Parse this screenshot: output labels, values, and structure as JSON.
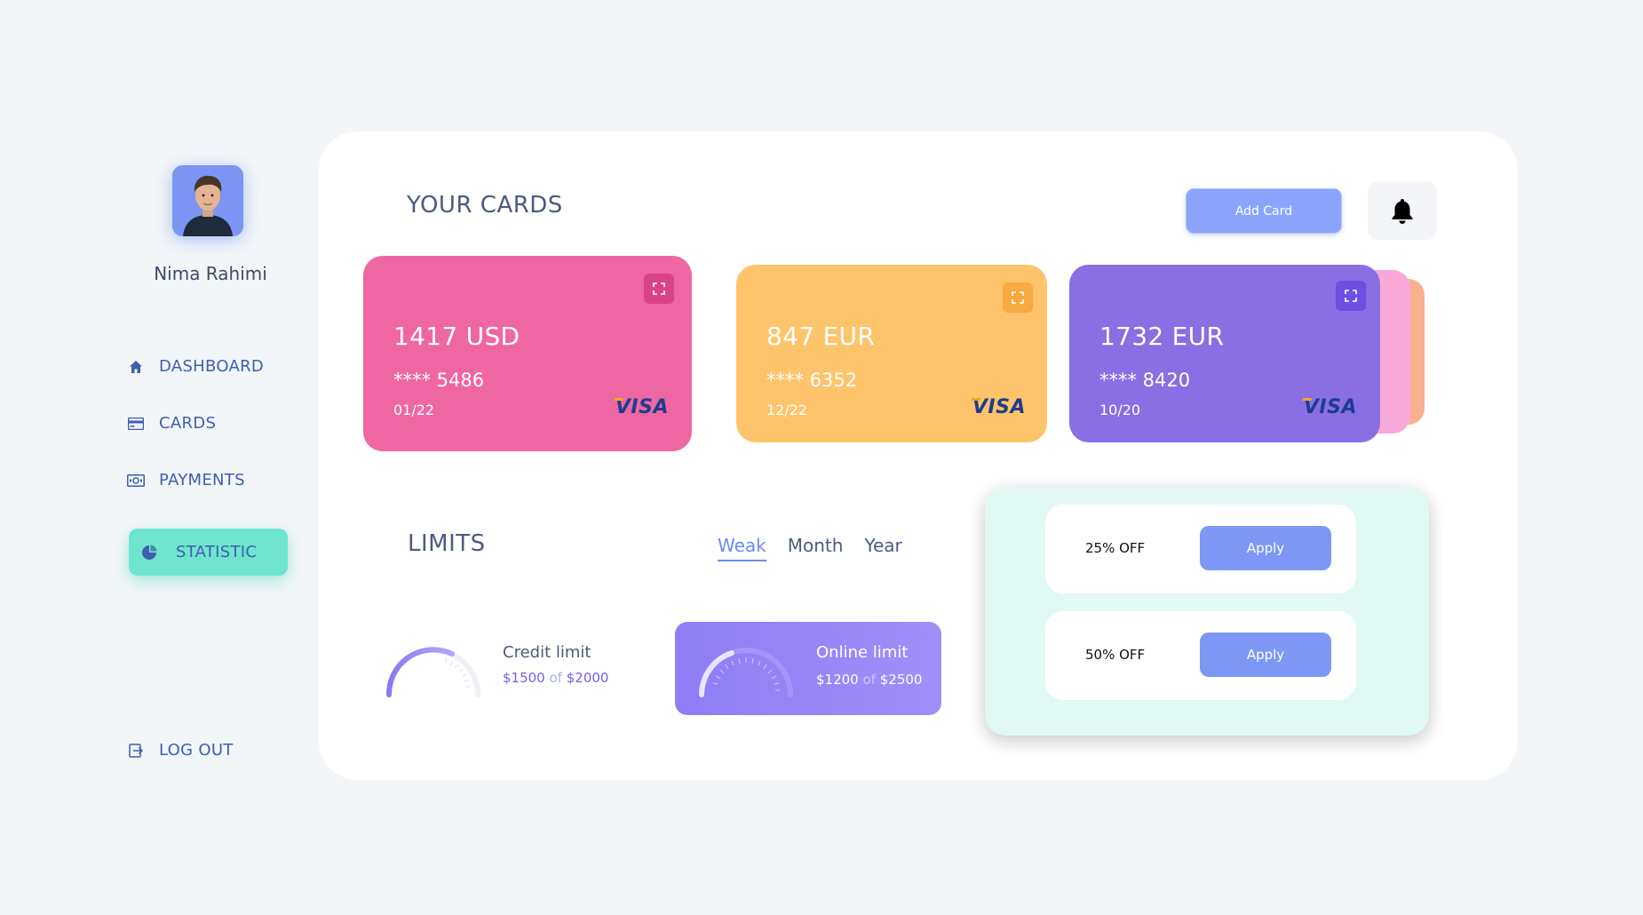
{
  "user": {
    "name": "Nima Rahimi"
  },
  "nav": {
    "dashboard": "DASHBOARD",
    "cards": "CARDS",
    "payments": "PAYMENTS",
    "statistic": "STATISTIC",
    "logout": "LOG OUT",
    "active": "statistic"
  },
  "header": {
    "title": "YOUR CARDS",
    "add_card": "Add Card"
  },
  "cards": [
    {
      "amount": "1417 USD",
      "number": "**** 5486",
      "expiry": "01/22",
      "brand": "VISA",
      "color": "#ee66a2"
    },
    {
      "amount": "847 EUR",
      "number": "**** 6352",
      "expiry": "12/22",
      "brand": "VISA",
      "color": "#fec46b"
    },
    {
      "amount": "1732 EUR",
      "number": "**** 8420",
      "expiry": "10/20",
      "brand": "VISA",
      "color": "#8a6ee3"
    }
  ],
  "limits": {
    "title": "LIMITS",
    "tabs": [
      "Weak",
      "Month",
      "Year"
    ],
    "active_tab": "Weak",
    "credit": {
      "name": "Credit limit",
      "used": "$1500",
      "of": "of",
      "total": "$2000"
    },
    "online": {
      "name": "Online limit",
      "used": "$1200",
      "of": "of",
      "total": "$2500"
    }
  },
  "offers": [
    {
      "label": "25% OFF",
      "button": "Apply"
    },
    {
      "label": "50% OFF",
      "button": "Apply"
    }
  ],
  "colors": {
    "accent": "#7c98f4",
    "active_nav": "#6ee5cc",
    "nav_text": "#3c5fb0"
  }
}
